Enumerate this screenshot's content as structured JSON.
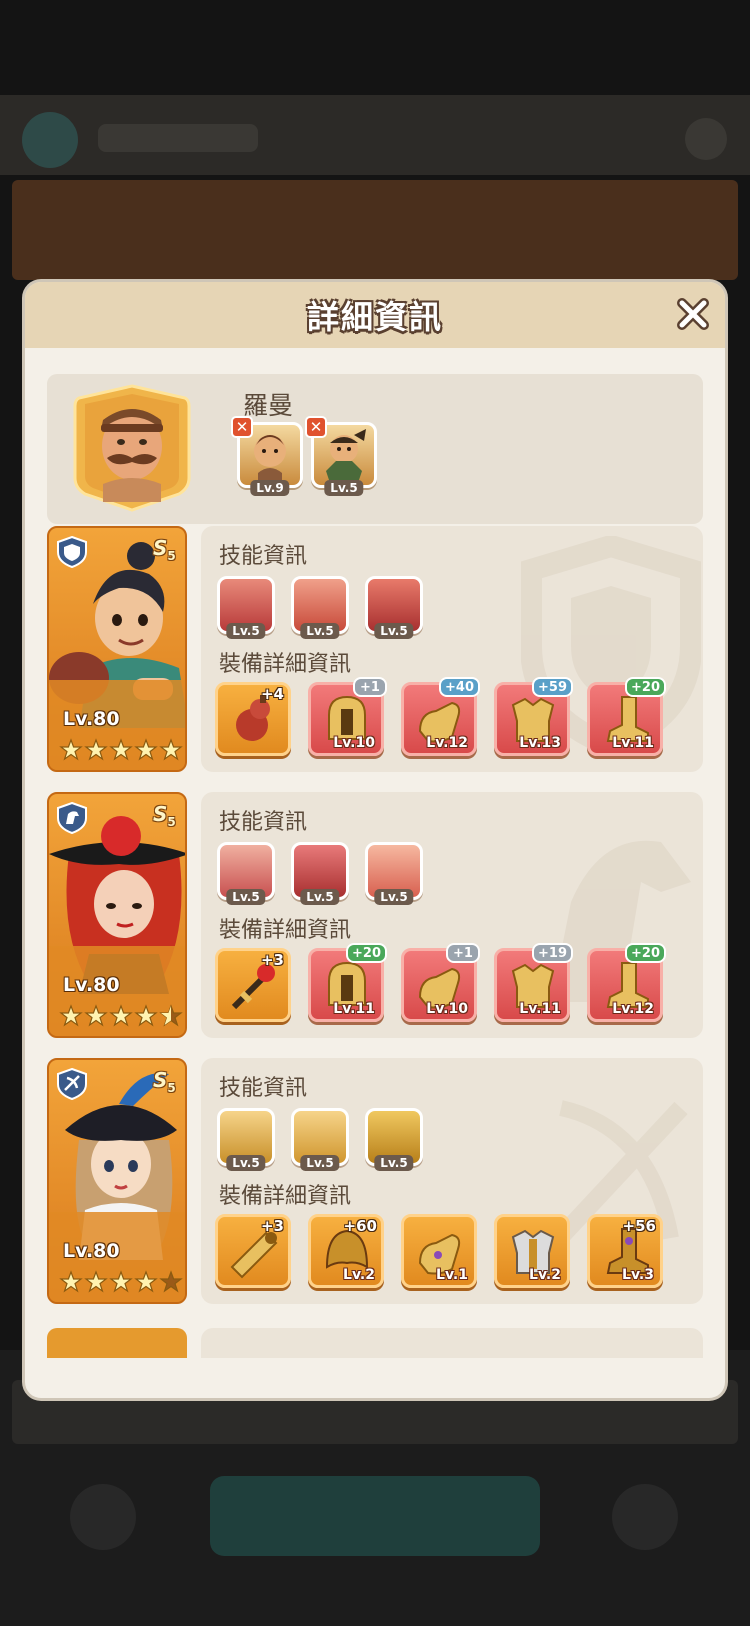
{
  "modal": {
    "title": "詳細資訊",
    "close_icon": "close-icon"
  },
  "player": {
    "name": "羅曼",
    "pets": [
      {
        "level": "Lv.9",
        "icon": "pet-lion-icon",
        "badge_icon": "disabled-x-icon"
      },
      {
        "level": "Lv.5",
        "icon": "pet-monkey-icon",
        "badge_icon": "disabled-x-icon"
      }
    ]
  },
  "labels": {
    "skills": "技能資訊",
    "equipment": "裝備詳細資訊"
  },
  "heroes": [
    {
      "class_icon": "shield-class-icon",
      "grade": "S",
      "grade_sub": "5",
      "level": "Lv.80",
      "stars": 5,
      "skills": [
        {
          "level": "Lv.5",
          "icon": "punch-skill-icon"
        },
        {
          "level": "Lv.5",
          "icon": "rage-skill-icon"
        },
        {
          "level": "Lv.5",
          "icon": "strike-skill-icon"
        }
      ],
      "equipment": [
        {
          "plus": "+4",
          "level": "",
          "color": "orange",
          "icon": "gourd-icon"
        },
        {
          "plus": "+1",
          "level": "Lv.10",
          "color": "red",
          "badge": "gray",
          "icon": "helmet-icon"
        },
        {
          "plus": "+40",
          "level": "Lv.12",
          "color": "red",
          "badge": "blue",
          "icon": "gauntlet-icon"
        },
        {
          "plus": "+59",
          "level": "Lv.13",
          "color": "red",
          "badge": "blue",
          "icon": "armor-icon"
        },
        {
          "plus": "+20",
          "level": "Lv.11",
          "color": "red",
          "badge": "green",
          "icon": "boots-icon"
        }
      ]
    },
    {
      "class_icon": "horse-class-icon",
      "grade": "S",
      "grade_sub": "5",
      "level": "Lv.80",
      "stars": 4.5,
      "skills": [
        {
          "level": "Lv.5",
          "icon": "cross-skill-icon"
        },
        {
          "level": "Lv.5",
          "icon": "rose-skill-icon"
        },
        {
          "level": "Lv.5",
          "icon": "cry-skill-icon"
        }
      ],
      "equipment": [
        {
          "plus": "+3",
          "level": "",
          "color": "orange",
          "icon": "rose-weapon-icon"
        },
        {
          "plus": "+20",
          "level": "Lv.11",
          "color": "red",
          "badge": "green",
          "icon": "helmet-icon"
        },
        {
          "plus": "+1",
          "level": "Lv.10",
          "color": "red",
          "badge": "gray",
          "icon": "gauntlet-icon"
        },
        {
          "plus": "+19",
          "level": "Lv.11",
          "color": "red",
          "badge": "gray",
          "icon": "armor-icon"
        },
        {
          "plus": "+20",
          "level": "Lv.12",
          "color": "red",
          "badge": "green",
          "icon": "boots-icon"
        }
      ]
    },
    {
      "class_icon": "crossbow-class-icon",
      "grade": "S",
      "grade_sub": "5",
      "level": "Lv.80",
      "stars": 4,
      "skills": [
        {
          "level": "Lv.5",
          "icon": "coin-skill-icon"
        },
        {
          "level": "Lv.5",
          "icon": "thumb-skill-icon"
        },
        {
          "level": "Lv.5",
          "icon": "gold-skill-icon"
        }
      ],
      "equipment": [
        {
          "plus": "+3",
          "level": "",
          "color": "orange",
          "icon": "cannon-icon"
        },
        {
          "plus": "+60",
          "level": "Lv.2",
          "color": "orange",
          "icon": "helmet-icon"
        },
        {
          "plus": "",
          "level": "Lv.1",
          "color": "orange",
          "icon": "gauntlet-icon"
        },
        {
          "plus": "",
          "level": "Lv.2",
          "color": "orange",
          "icon": "armor-icon"
        },
        {
          "plus": "+56",
          "level": "Lv.3",
          "color": "orange",
          "icon": "boots-icon"
        }
      ]
    }
  ]
}
